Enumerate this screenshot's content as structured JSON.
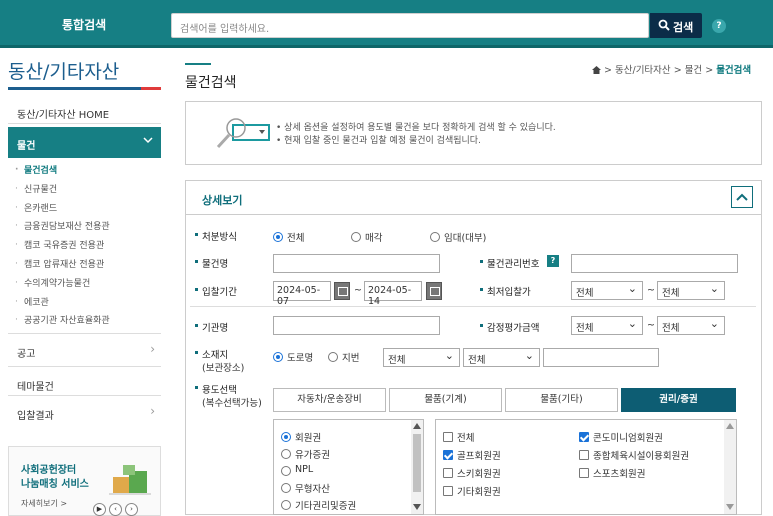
{
  "header": {
    "title": "통합검색",
    "search_placeholder": "검색어를 입력하세요.",
    "search_button": "검색",
    "help": "?"
  },
  "sidebar": {
    "title": "동산/기타자산",
    "home": "동산/기타자산 HOME",
    "active": "물건",
    "submenu": [
      "물건검색",
      "신규물건",
      "온카랜드",
      "금융권담보재산 전용관",
      "캠코 국유증권 전용관",
      "캠코 압류재산 전용관",
      "수의계약가능물건",
      "에코관",
      "공공기관 자산효율화관"
    ],
    "items": [
      "공고",
      "테마물건",
      "입찰결과"
    ],
    "banner": {
      "line1": "사회공헌장터",
      "line2": "나눔매칭 서비스",
      "more": "자세히보기 >"
    }
  },
  "page": {
    "title": "물건검색",
    "breadcrumb": [
      "동산/기타자산",
      "물건",
      "물건검색"
    ],
    "info_lines": [
      "상세 옵션을 설정하여 용도별 물건을 보다 정확하게 검색 할 수 있습니다.",
      "현재 입찰 중인 물건과 입찰 예정 물건이 검색됩니다."
    ]
  },
  "detail": {
    "title": "상세보기",
    "labels": {
      "disposal": "처분방식",
      "name": "물건명",
      "mgmt_no": "물건관리번호",
      "period": "입찰기간",
      "min_bid": "최저입찰가",
      "agency": "기관명",
      "appraisal": "감정평가금액",
      "location1": "소재지",
      "location2": "(보관장소)",
      "usage1": "용도선택",
      "usage2": "(복수선택가능)"
    },
    "disposal_options": [
      "전체",
      "매각",
      "임대(대부)"
    ],
    "date_from": "2024-05-07",
    "date_to": "2024-05-14",
    "tilde": "~",
    "select_all": "전체",
    "location_options": [
      "도로명",
      "지번"
    ],
    "usage_tabs": [
      "자동차/운송장비",
      "물품(기계)",
      "물품(기타)",
      "권리/증권"
    ],
    "left_list": [
      "회원권",
      "유가증권",
      "NPL",
      "무형자산",
      "기타권리및증권"
    ],
    "right_list": [
      "전체",
      "콘도미니엄회원권",
      "골프회원권",
      "종합체육시설이용회원권",
      "스키회원권",
      "스포츠회원권",
      "기타회원권"
    ]
  },
  "colors": {
    "brand": "#167f84",
    "nav_dark": "#0b2c48",
    "tab_active": "#0d5d73",
    "check": "#1a72d8"
  }
}
